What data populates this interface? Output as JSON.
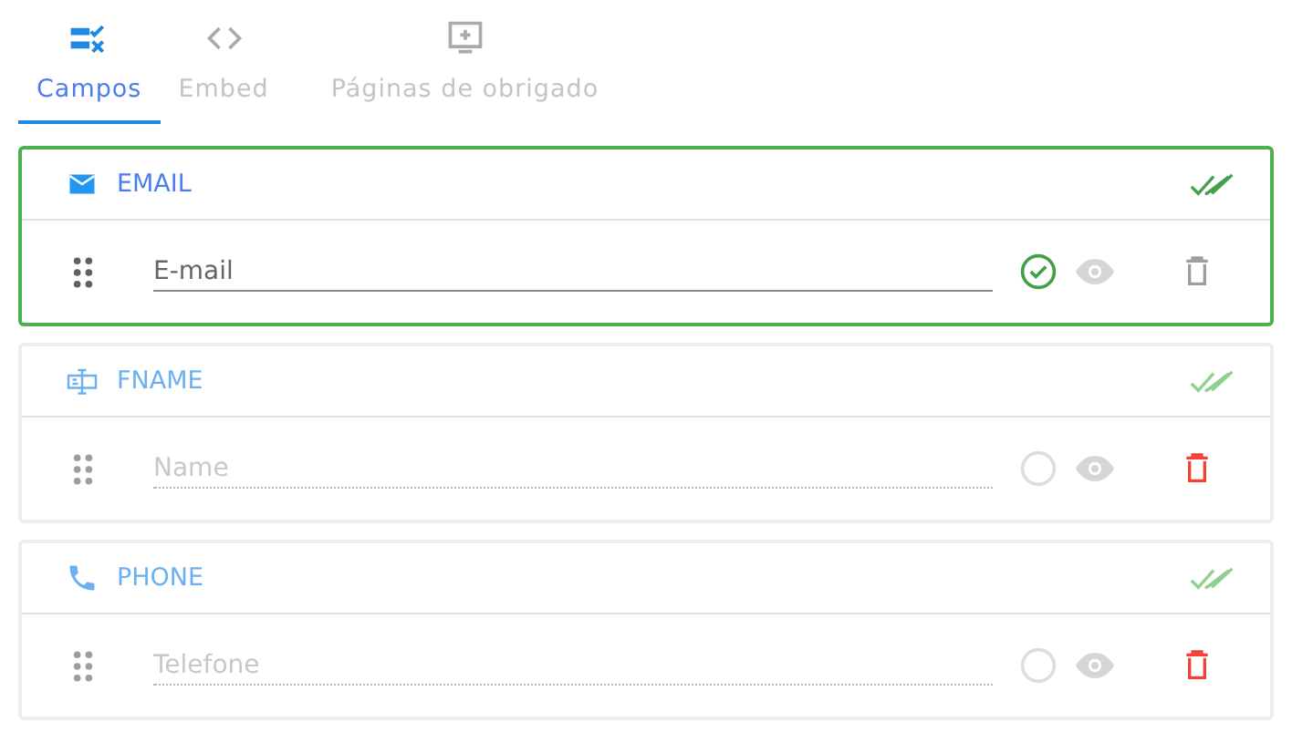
{
  "tabs": [
    {
      "label": "Campos",
      "kind": "checklist",
      "selected": true
    },
    {
      "label": "Embed",
      "kind": "code",
      "selected": false
    },
    {
      "label": "Páginas de obrigado",
      "kind": "monitor",
      "selected": false
    }
  ],
  "fields": [
    {
      "name": "EMAIL",
      "kind": "email",
      "placeholder": "E-mail",
      "selected": true,
      "required": true,
      "deletable": false
    },
    {
      "name": "FNAME",
      "kind": "text",
      "placeholder": "Name",
      "selected": false,
      "required": false,
      "deletable": true
    },
    {
      "name": "PHONE",
      "kind": "phone",
      "placeholder": "Telefone",
      "selected": false,
      "required": false,
      "deletable": true
    }
  ]
}
